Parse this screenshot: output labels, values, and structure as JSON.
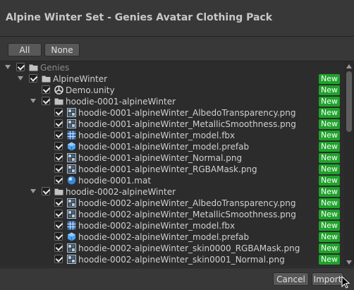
{
  "window": {
    "title": "Alpine Winter Set - Genies Avatar Clothing Pack"
  },
  "toolbar": {
    "all_label": "All",
    "none_label": "None"
  },
  "tree": {
    "badge_label": "New",
    "rows": [
      {
        "label": "Genies",
        "type": "folder",
        "expanded": true,
        "dim": true,
        "badge": false
      },
      {
        "label": "AlpineWinter",
        "type": "folder",
        "expanded": true,
        "badge": true
      },
      {
        "label": "Demo.unity",
        "type": "unity",
        "badge": true
      },
      {
        "label": "hoodie-0001-alpineWinter",
        "type": "folder",
        "expanded": true,
        "badge": true
      },
      {
        "label": "hoodie-0001-alpineWinter_AlbedoTransparency.png",
        "type": "texture",
        "badge": true
      },
      {
        "label": "hoodie-0001-alpineWinter_MetallicSmoothness.png",
        "type": "texture",
        "badge": true
      },
      {
        "label": "hoodie-0001-alpineWinter_model.fbx",
        "type": "model",
        "badge": true
      },
      {
        "label": "hoodie-0001-alpineWinter_model.prefab",
        "type": "prefab",
        "badge": true
      },
      {
        "label": "hoodie-0001-alpineWinter_Normal.png",
        "type": "texture",
        "badge": true
      },
      {
        "label": "hoodie-0001-alpineWinter_RGBAMask.png",
        "type": "texture",
        "badge": true
      },
      {
        "label": "hoodie-0001.mat",
        "type": "material",
        "badge": true
      },
      {
        "label": "hoodie-0002-alpineWinter",
        "type": "folder",
        "expanded": true,
        "badge": true
      },
      {
        "label": "hoodie-0002-alpineWinter_AlbedoTransparency.png",
        "type": "texture",
        "badge": true
      },
      {
        "label": "hoodie-0002-alpineWinter_MetallicSmoothness.png",
        "type": "texture",
        "badge": true
      },
      {
        "label": "hoodie-0002-alpineWinter_model.fbx",
        "type": "model",
        "badge": true
      },
      {
        "label": "hoodie-0002-alpineWinter_model.prefab",
        "type": "prefab",
        "badge": true
      },
      {
        "label": "hoodie-0002-alpineWinter_skin0000_RGBAMask.png",
        "type": "texture",
        "badge": true
      },
      {
        "label": "hoodie-0002-alpineWinter_skin0001_Normal.png",
        "type": "texture",
        "badge": true
      }
    ]
  },
  "footer": {
    "cancel_label": "Cancel",
    "import_label": "Import"
  },
  "colors": {
    "badge": "#1fa32b",
    "background": "#383838",
    "panel": "#2c2c2c"
  }
}
